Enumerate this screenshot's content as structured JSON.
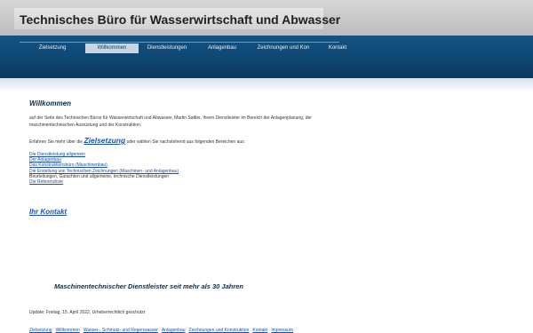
{
  "site": {
    "title": "Technisches Büro für Wasserwirtschaft und Abwasser"
  },
  "nav": {
    "items": [
      {
        "label": "Zielsetzung",
        "active": false
      },
      {
        "label": "Willkommen",
        "active": true
      },
      {
        "label": "Dienstleistungen",
        "active": false
      },
      {
        "label": "Anlagenbau",
        "active": false
      },
      {
        "label": "Zeichnungen und Kon",
        "active": false
      },
      {
        "label": "Kontakt",
        "active": false
      }
    ]
  },
  "main": {
    "heading": "Willkommen",
    "intro": "auf der Seite des Technischen Büros für Wasserwirtschaft und Abwasser, Martin Sattler, Ihrem Dienstleister im Bereich der Anlagenplanung, der maschinentechnischen Ausrüstung und der Konstruktion.",
    "choose_prefix": "Erfahren Sie mehr über die",
    "choose_link": "Zielsetzung",
    "choose_suffix": "oder wählen Sie nachstehend aus folgenden Bereichen aus:",
    "areas": [
      {
        "text": "Die Dienstleistung allgemein",
        "link": true
      },
      {
        "text": "Der Anlagenbau",
        "link": true
      },
      {
        "text": "Das Konstruktionsbüro (Maschinenbau)",
        "link": true
      },
      {
        "text": "Die Erstellung von Technischen Zeichnungen (Maschinen- und Anlagenbau)",
        "link": true
      },
      {
        "text": "Beurteilungen, Gutachten und allgemeine, technische Dienstleistungen",
        "link": false
      },
      {
        "text": "Die Referenzliste",
        "link": true
      }
    ],
    "contact_link": "Ihr Kontakt",
    "slogan": "Maschinentechnischer Dienstleister seit mehr als 30 Jahren",
    "update": "Update: Freitag, 15. April 2022, Urheberrechtlich geschützt"
  },
  "footer": {
    "links": [
      "Zielsetzung",
      "Willkommen",
      "Wasser-, Schmutz- und Regenwasser",
      "Anlagenbau",
      "Zeichnungen und Konstruktion",
      "Kontakt",
      "Impressum"
    ]
  },
  "colors": {
    "nav_band": "#0f4a78",
    "link": "#1d4eaa",
    "heading": "#0d2a4c"
  }
}
